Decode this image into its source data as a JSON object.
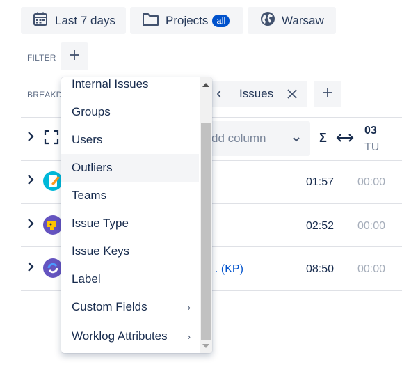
{
  "toolbar": {
    "date_range": "Last 7 days",
    "projects": "Projects",
    "projects_badge": "all",
    "timezone": "Warsaw"
  },
  "filter": {
    "label": "FILTER"
  },
  "breakdown": {
    "label": "BREAKD",
    "chip": "Issues"
  },
  "table": {
    "add_column_placeholder": "dd column",
    "sum_symbol": "Σ",
    "day_number": "03",
    "day_name": "TU",
    "rows": [
      {
        "link_text": "",
        "total": "01:57",
        "day": "00:00"
      },
      {
        "link_text": "",
        "total": "02:52",
        "day": "00:00"
      },
      {
        "link_text": ". (KP)",
        "total": "08:50",
        "day": "00:00"
      }
    ]
  },
  "dropdown": {
    "items": [
      {
        "label": "Internal Issues",
        "submenu": false
      },
      {
        "label": "Groups",
        "submenu": false
      },
      {
        "label": "Users",
        "submenu": false
      },
      {
        "label": "Outliers",
        "submenu": false,
        "highlighted": true
      },
      {
        "label": "Teams",
        "submenu": false
      },
      {
        "label": "Issue Type",
        "submenu": false
      },
      {
        "label": "Issue Keys",
        "submenu": false
      },
      {
        "label": "Label",
        "submenu": false
      },
      {
        "label": "Custom Fields",
        "submenu": true
      },
      {
        "label": "Worklog Attributes",
        "submenu": true
      }
    ]
  },
  "colors": {
    "accent": "#0052cc",
    "link": "#0052cc"
  }
}
